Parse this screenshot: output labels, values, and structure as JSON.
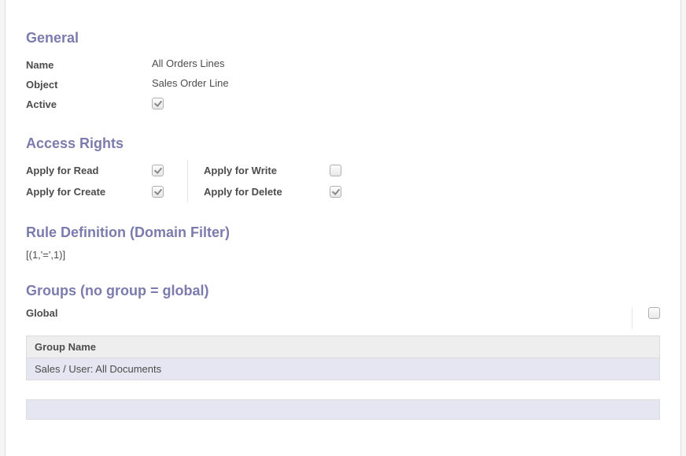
{
  "general": {
    "heading": "General",
    "name_label": "Name",
    "name_value": "All Orders Lines",
    "object_label": "Object",
    "object_value": "Sales Order Line",
    "active_label": "Active",
    "active_checked": true
  },
  "access": {
    "heading": "Access Rights",
    "read_label": "Apply for Read",
    "read_checked": true,
    "write_label": "Apply for Write",
    "write_checked": false,
    "create_label": "Apply for Create",
    "create_checked": true,
    "delete_label": "Apply for Delete",
    "delete_checked": true
  },
  "rule": {
    "heading": "Rule Definition (Domain Filter)",
    "domain": "[(1,'=',1)]"
  },
  "groups": {
    "heading": "Groups (no group = global)",
    "global_label": "Global",
    "global_checked": false,
    "column_header": "Group Name",
    "rows": [
      {
        "name": "Sales / User: All Documents"
      }
    ]
  }
}
